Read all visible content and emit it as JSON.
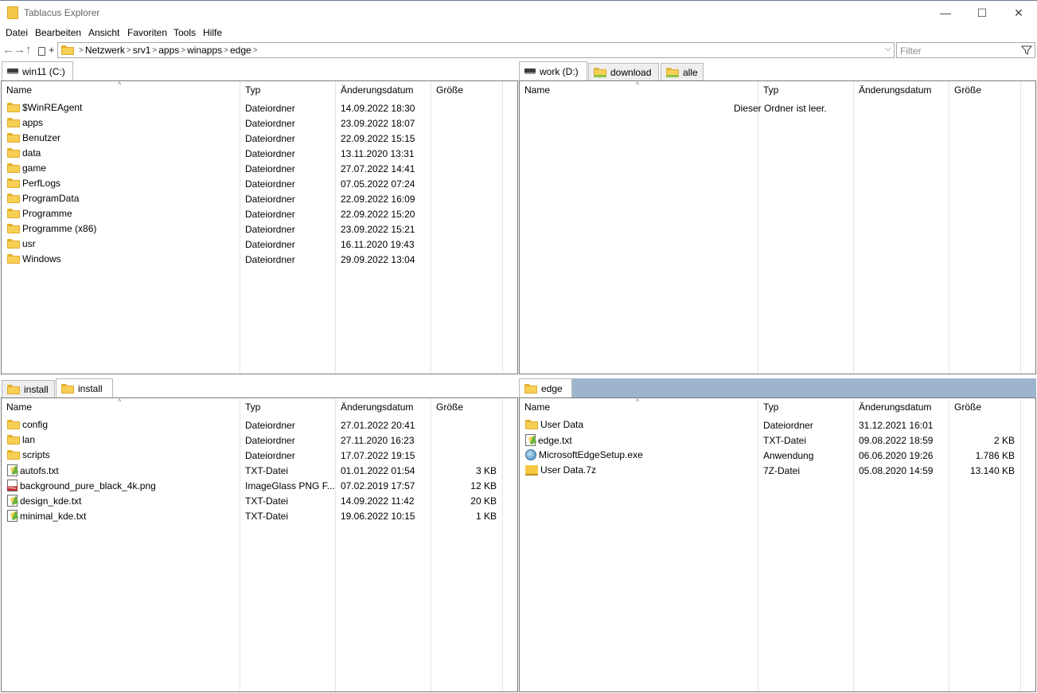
{
  "window": {
    "title": "Tablacus Explorer",
    "minimize": "—",
    "maximize": "☐",
    "close": "✕"
  },
  "menu": [
    "Datei",
    "Bearbeiten",
    "Ansicht",
    "Favoriten",
    "Tools",
    "Hilfe"
  ],
  "toolbar": {
    "back": "←",
    "forward": "→",
    "up": "↑",
    "add": "+",
    "breadcrumb": [
      "Netzwerk",
      "srv1",
      "apps",
      "winapps",
      "edge"
    ],
    "filter_placeholder": "Filter"
  },
  "columns": {
    "name": "Name",
    "type": "Typ",
    "date": "Änderungsdatum",
    "size": "Größe"
  },
  "panes": {
    "top_left": {
      "tabs": [
        {
          "label": "win11 (C:)",
          "icon": "drive-icon",
          "active": true
        }
      ],
      "rows": [
        {
          "name": "$WinREAgent",
          "type": "Dateiordner",
          "date": "14.09.2022 18:30",
          "size": "",
          "icon": "folder-icon"
        },
        {
          "name": "apps",
          "type": "Dateiordner",
          "date": "23.09.2022 18:07",
          "size": "",
          "icon": "folder-icon"
        },
        {
          "name": "Benutzer",
          "type": "Dateiordner",
          "date": "22.09.2022 15:15",
          "size": "",
          "icon": "folder-icon"
        },
        {
          "name": "data",
          "type": "Dateiordner",
          "date": "13.11.2020 13:31",
          "size": "",
          "icon": "folder-icon"
        },
        {
          "name": "game",
          "type": "Dateiordner",
          "date": "27.07.2022 14:41",
          "size": "",
          "icon": "folder-icon"
        },
        {
          "name": "PerfLogs",
          "type": "Dateiordner",
          "date": "07.05.2022 07:24",
          "size": "",
          "icon": "folder-icon"
        },
        {
          "name": "ProgramData",
          "type": "Dateiordner",
          "date": "22.09.2022 16:09",
          "size": "",
          "icon": "folder-icon"
        },
        {
          "name": "Programme",
          "type": "Dateiordner",
          "date": "22.09.2022 15:20",
          "size": "",
          "icon": "folder-icon"
        },
        {
          "name": "Programme (x86)",
          "type": "Dateiordner",
          "date": "23.09.2022 15:21",
          "size": "",
          "icon": "folder-icon"
        },
        {
          "name": "usr",
          "type": "Dateiordner",
          "date": "16.11.2020 19:43",
          "size": "",
          "icon": "folder-icon"
        },
        {
          "name": "Windows",
          "type": "Dateiordner",
          "date": "29.09.2022 13:04",
          "size": "",
          "icon": "folder-icon"
        }
      ]
    },
    "top_right": {
      "tabs": [
        {
          "label": "work (D:)",
          "icon": "drive-icon",
          "active": true
        },
        {
          "label": "download",
          "icon": "folder-icon",
          "active": false
        },
        {
          "label": "alle",
          "icon": "folder-icon",
          "active": false
        }
      ],
      "empty_message": "Dieser Ordner ist leer.",
      "rows": []
    },
    "bottom_left": {
      "tabs": [
        {
          "label": "install",
          "icon": "folder-icon",
          "active": false
        },
        {
          "label": "install",
          "icon": "folder-icon",
          "active": true
        }
      ],
      "rows": [
        {
          "name": "config",
          "type": "Dateiordner",
          "date": "27.01.2022 20:41",
          "size": "",
          "icon": "folder-icon"
        },
        {
          "name": "lan",
          "type": "Dateiordner",
          "date": "27.11.2020 16:23",
          "size": "",
          "icon": "folder-icon"
        },
        {
          "name": "scripts",
          "type": "Dateiordner",
          "date": "17.07.2022 19:15",
          "size": "",
          "icon": "folder-icon"
        },
        {
          "name": "autofs.txt",
          "type": "TXT-Datei",
          "date": "01.01.2022 01:54",
          "size": "3 KB",
          "icon": "text-file-icon"
        },
        {
          "name": "background_pure_black_4k.png",
          "type": "ImageGlass PNG F...",
          "date": "07.02.2019 17:57",
          "size": "12 KB",
          "icon": "png-file-icon"
        },
        {
          "name": "design_kde.txt",
          "type": "TXT-Datei",
          "date": "14.09.2022 11:42",
          "size": "20 KB",
          "icon": "text-file-icon"
        },
        {
          "name": "minimal_kde.txt",
          "type": "TXT-Datei",
          "date": "19.06.2022 10:15",
          "size": "1 KB",
          "icon": "text-file-icon"
        }
      ]
    },
    "bottom_right": {
      "tabs": [
        {
          "label": "edge",
          "icon": "folder-icon",
          "active": true
        }
      ],
      "rows": [
        {
          "name": "User Data",
          "type": "Dateiordner",
          "date": "31.12.2021 16:01",
          "size": "",
          "icon": "folder-icon"
        },
        {
          "name": "edge.txt",
          "type": "TXT-Datei",
          "date": "09.08.2022 18:59",
          "size": "2 KB",
          "icon": "text-file-icon"
        },
        {
          "name": "MicrosoftEdgeSetup.exe",
          "type": "Anwendung",
          "date": "06.06.2020 19:26",
          "size": "1.786 KB",
          "icon": "exe-file-icon"
        },
        {
          "name": "User Data.7z",
          "type": "7Z-Datei",
          "date": "05.08.2020 14:59",
          "size": "13.140 KB",
          "icon": "archive-file-icon"
        }
      ]
    }
  }
}
